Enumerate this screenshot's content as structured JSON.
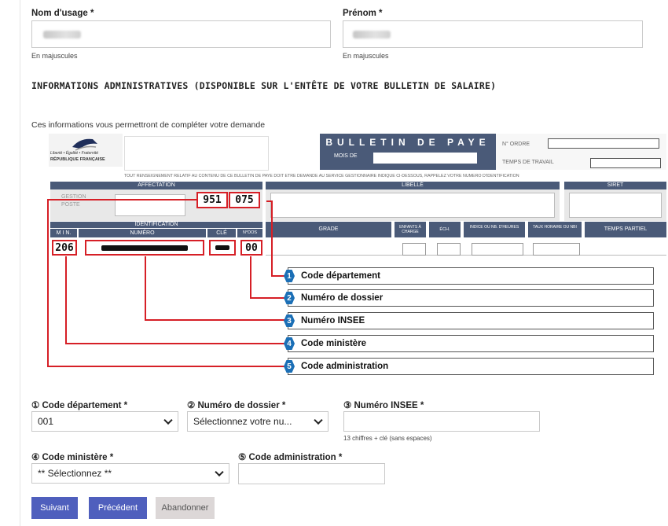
{
  "form": {
    "nom_label": "Nom d'usage",
    "prenom_label": "Prénom",
    "required_mark": "*",
    "nom_hint": "En majuscules",
    "prenom_hint": "En majuscules",
    "section_title": "INFORMATIONS ADMINISTRATIVES (DISPONIBLE SUR L'ENTÊTE DE VOTRE BULLETIN DE SALAIRE)",
    "section_desc": "Ces informations vous permettront de compléter votre demande"
  },
  "payslip": {
    "brand_motto": "Liberté • Égalité • Fraternité",
    "brand_name": "RÉPUBLIQUE FRANÇAISE",
    "title": "BULLETIN DE PAYE",
    "mois_de": "MOIS DE",
    "n_ordre": "N° ORDRE",
    "temps_de_travail": "TEMPS DE TRAVAIL",
    "notice": "TOUT RENSEIGNEMENT RELATIF AU CONTENU DE CE BULLETIN DE PAYE DOIT ÊTRE DEMANDÉ AU SERVICE GESTIONNAIRE INDIQUÉ CI-DESSOUS, RAPPELEZ VOTRE NUMÉRO D'IDENTIFICATION",
    "affectation": "AFFECTATION",
    "libelle": "LIBELLÉ",
    "siret": "SIRET",
    "gestion": "GESTION",
    "poste": "POSTE",
    "code_dept_value": "951",
    "num_dossier_value": "075",
    "identification": "IDENTIFICATION",
    "min": "M I N.",
    "numero": "NUMÉRO",
    "cle": "CLÉ",
    "n_dos": "N°DOS",
    "grade": "GRADE",
    "enfants_a_charge": "ENFANTS À CHARGE",
    "ech": "ÉCH.",
    "indice_ou_nb_heures": "INDICE OU NB. D'HEURES",
    "taux_horaire_ou_nbi": "TAUX HORAIRE OU NBI",
    "temps_partiel": "TEMPS PARTIEL",
    "min_value": "206",
    "dos_value": "00"
  },
  "callouts": [
    {
      "num": "1",
      "label": "Code département"
    },
    {
      "num": "2",
      "label": "Numéro de dossier"
    },
    {
      "num": "3",
      "label": "Numéro INSEE"
    },
    {
      "num": "4",
      "label": "Code ministère"
    },
    {
      "num": "5",
      "label": "Code administration"
    }
  ],
  "fields": {
    "code_departement": {
      "label": "① Code département",
      "value": "001"
    },
    "numero_dossier": {
      "label": "② Numéro de dossier",
      "value": "Sélectionnez votre nu..."
    },
    "numero_insee": {
      "label": "③ Numéro INSEE",
      "hint": "13 chiffres + clé (sans espaces)",
      "value": ""
    },
    "code_ministere": {
      "label": "④ Code ministère",
      "value": "** Sélectionnez **"
    },
    "code_administration": {
      "label": "⑤ Code administration",
      "value": ""
    }
  },
  "buttons": {
    "suivant": "Suivant",
    "precedent": "Précédent",
    "abandonner": "Abandonner"
  },
  "colors": {
    "primary_button": "#4f5fbd",
    "secondary_button": "#dcd7d7",
    "highlight_red": "#d61f26",
    "callout_blue": "#1b6fb6",
    "payslip_header": "#4a5a78"
  }
}
